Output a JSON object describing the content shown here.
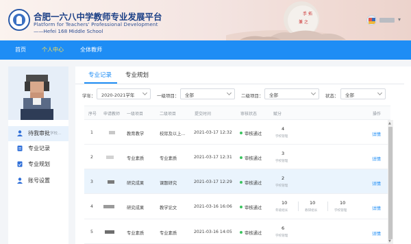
{
  "header": {
    "title_cn": "合肥一六八中学教师专业发展平台",
    "title_en_line1": "Platform for Teachers' Professional Development",
    "title_en_line2": "——Hefei 168 Middle School",
    "user_caret": "▾"
  },
  "nav": {
    "items": [
      {
        "label": "首页"
      },
      {
        "label": "个人中心"
      },
      {
        "label": "全体教师"
      }
    ],
    "active_color": "#ffe14d",
    "bar_color": "#1e8df5"
  },
  "sidebar": {
    "items": [
      {
        "label": "待我审批",
        "badge": "学校..."
      },
      {
        "label": "专业记录"
      },
      {
        "label": "专业规划"
      },
      {
        "label": "账号设置"
      }
    ]
  },
  "tabs": [
    {
      "label": "专业记录"
    },
    {
      "label": "专业规划"
    }
  ],
  "filters": [
    {
      "label": "学年：",
      "value": "2020-2021学年"
    },
    {
      "label": "一级项目：",
      "value": "全部"
    },
    {
      "label": "二级项目：",
      "value": "全部"
    },
    {
      "label": "状态：",
      "value": "全部"
    }
  ],
  "table": {
    "columns": [
      "序号",
      "申请教师",
      "一级项目",
      "二级项目",
      "提交时间",
      "审核状态",
      "赋分",
      "操作"
    ],
    "rows": [
      {
        "no": "1",
        "level1": "教育教学",
        "level2": "校际及以上...",
        "time": "2021-03-17 12:32",
        "status": "审核通过",
        "scores": [
          {
            "value": "4",
            "source": "学校管理"
          }
        ],
        "op": "详情"
      },
      {
        "no": "2",
        "level1": "专业素质",
        "level2": "专业素质",
        "time": "2021-03-17 12:31",
        "status": "审核通过",
        "scores": [
          {
            "value": "3",
            "source": "学校管理"
          }
        ],
        "op": "详情"
      },
      {
        "no": "3",
        "level1": "研究成果",
        "level2": "课题研究",
        "time": "2021-03-17 12:29",
        "status": "审核通过",
        "scores": [
          {
            "value": "2",
            "source": "学校管理"
          }
        ],
        "op": "详情"
      },
      {
        "no": "4",
        "level1": "研究成果",
        "level2": "教学论文",
        "time": "2021-03-16 16:06",
        "status": "审核通过",
        "scores": [
          {
            "value": "10",
            "source": "年级组长"
          },
          {
            "value": "10",
            "source": "教研组长"
          },
          {
            "value": "10",
            "source": "学校管理"
          }
        ],
        "op": "详情"
      },
      {
        "no": "5",
        "level1": "专业素质",
        "level2": "专业素质",
        "time": "2021-03-16 14:05",
        "status": "审核通过",
        "scores": [
          {
            "value": "6",
            "source": "学校管理"
          }
        ],
        "op": "详情"
      }
    ]
  },
  "status_color": "#3cc45f",
  "link_color": "#1e8df5"
}
